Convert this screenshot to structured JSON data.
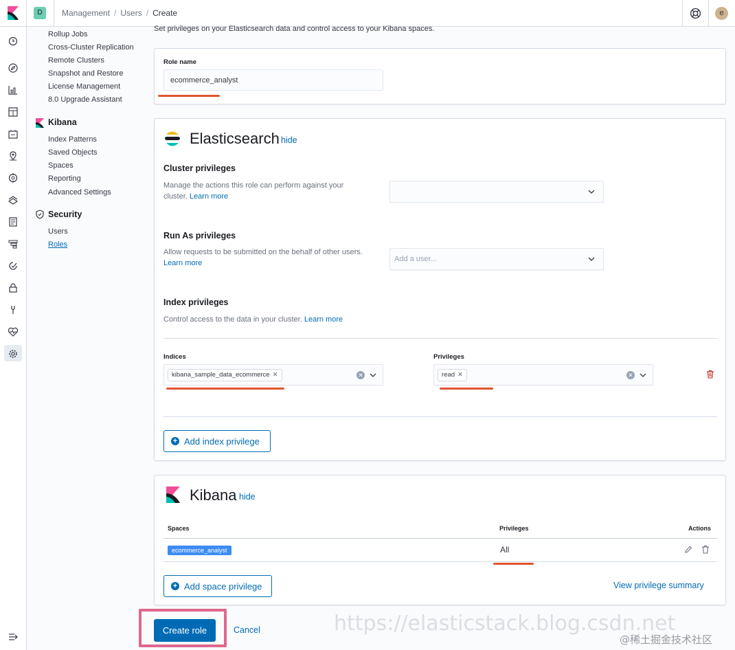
{
  "header": {
    "space_initial": "D",
    "breadcrumbs": [
      "Management",
      "Users",
      "Create"
    ],
    "breadcrumb_separator": "/",
    "avatar_initial": "e"
  },
  "iconnav": {
    "icons": [
      "clock-icon",
      "compass-icon",
      "visualize-icon",
      "dashboard-icon",
      "canvas-icon",
      "maps-icon",
      "ml-icon",
      "infrastructure-icon",
      "logs-icon",
      "apm-icon",
      "uptime-icon",
      "siem-icon",
      "devtools-icon",
      "monitoring-icon",
      "management-gear-icon"
    ],
    "collapse_icon": "collapse-nav-icon"
  },
  "sidebar": {
    "top_items": [
      "Rollup Jobs",
      "Cross-Cluster Replication",
      "Remote Clusters",
      "Snapshot and Restore",
      "License Management",
      "8.0 Upgrade Assistant"
    ],
    "kibana_title": "Kibana",
    "kibana_items": [
      "Index Patterns",
      "Saved Objects",
      "Spaces",
      "Reporting",
      "Advanced Settings"
    ],
    "security_title": "Security",
    "security_items": [
      "Users",
      "Roles"
    ]
  },
  "main": {
    "intro": "Set privileges on your Elasticsearch data and control access to your Kibana spaces.",
    "role_name_label": "Role name",
    "role_name_value": "ecommerce_analyst",
    "elasticsearch": {
      "title": "Elasticsearch",
      "hide": "hide",
      "cluster_title": "Cluster privileges",
      "cluster_desc": "Manage the actions this role can perform against your cluster.",
      "learn_more": "Learn more",
      "runas_title": "Run As privileges",
      "runas_desc": "Allow requests to be submitted on the behalf of other users.",
      "runas_placeholder": "Add a user...",
      "index_title": "Index privileges",
      "index_desc": "Control access to the data in your cluster.",
      "indices_label": "Indices",
      "indices_value": "kibana_sample_data_ecommerce",
      "privileges_label": "Privileges",
      "privileges_value": "read",
      "add_index_privilege": "Add index privilege"
    },
    "kibana": {
      "title": "Kibana",
      "hide": "hide",
      "col_spaces": "Spaces",
      "col_privileges": "Privileges",
      "col_actions": "Actions",
      "row_space": "ecommerce_analyst",
      "row_privilege": "All",
      "add_space_privilege": "Add space privilege",
      "view_summary": "View privilege summary"
    },
    "create_role": "Create role",
    "cancel": "Cancel"
  },
  "watermark": {
    "url": "https://elasticstack.blog.csdn.net",
    "site": "@稀土掘金技术社区"
  },
  "colors": {
    "accent": "#006bb4",
    "annotation_underline": "#e0542e",
    "highlight_border": "#e0668c",
    "space_tag": "#3d8cf2"
  }
}
